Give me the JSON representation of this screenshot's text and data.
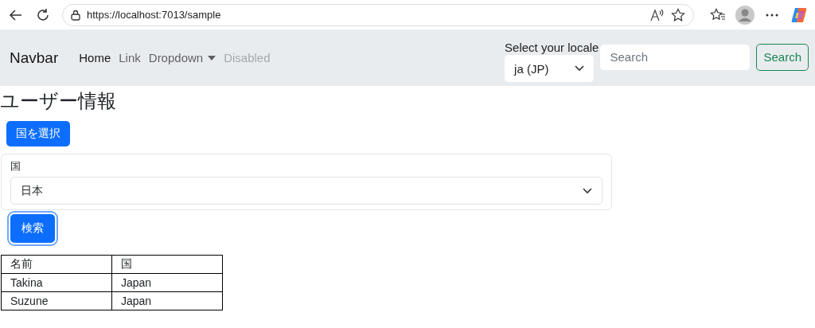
{
  "browser": {
    "url": "https://localhost:7013/sample"
  },
  "navbar": {
    "brand": "Navbar",
    "links": [
      {
        "label": "Home",
        "kind": "link",
        "selected": true,
        "disabled": false
      },
      {
        "label": "Link",
        "kind": "link",
        "selected": false,
        "disabled": false
      },
      {
        "label": "Dropdown",
        "kind": "dropdown",
        "selected": false,
        "disabled": false
      },
      {
        "label": "Disabled",
        "kind": "link",
        "selected": false,
        "disabled": true
      }
    ],
    "locale": {
      "label": "Select your locale",
      "value": "ja (JP)"
    },
    "search": {
      "placeholder": "Search",
      "button": "Search"
    }
  },
  "page": {
    "title": "ユーザー情報",
    "select_country_button": "国を選択",
    "country_field": {
      "label": "国",
      "value": "日本"
    },
    "search_button": {
      "label": "検索",
      "focused": true
    },
    "table": {
      "columns": [
        "名前",
        "国"
      ],
      "rows": [
        [
          "Takina",
          "Japan"
        ],
        [
          "Suzune",
          "Japan"
        ]
      ]
    }
  }
}
